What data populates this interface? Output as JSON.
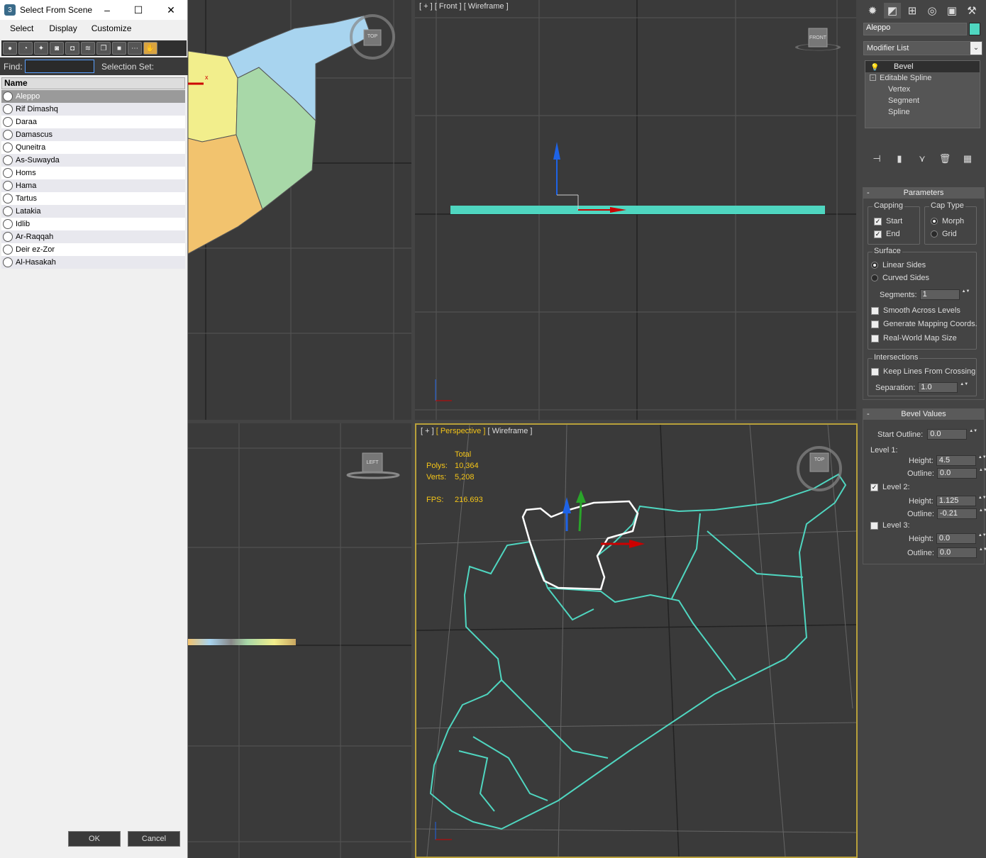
{
  "dialog": {
    "title": "Select From Scene",
    "menu": [
      "Select",
      "Display",
      "Customize"
    ],
    "find_label": "Find:",
    "find_value": "",
    "selection_set_label": "Selection Set:",
    "column_header": "Name",
    "items": [
      "Aleppo",
      "Rif Dimashq",
      "Daraa",
      "Damascus",
      "Quneitra",
      "As-Suwayda",
      "Homs",
      "Hama",
      "Tartus",
      "Latakia",
      "Idlib",
      "Ar-Raqqah",
      "Deir ez-Zor",
      "Al-Hasakah"
    ],
    "selected_index": 0,
    "ok_label": "OK",
    "cancel_label": "Cancel"
  },
  "viewports": {
    "top": {
      "cube_label": "TOP"
    },
    "front": {
      "plus": "[ + ]",
      "view": "[ Front ]",
      "shading": "[ Wireframe ]",
      "cube_label": "FRONT"
    },
    "left": {
      "cube_label": "LEFT"
    },
    "perspective": {
      "plus": "[ + ]",
      "view": "[ Perspective ]",
      "shading": "[ Wireframe ]",
      "cube_label": "TOP",
      "stats": {
        "total_label": "Total",
        "polys_label": "Polys:",
        "polys": "10,364",
        "verts_label": "Verts:",
        "verts": "5,208",
        "fps_label": "FPS:",
        "fps": "216.693"
      }
    }
  },
  "panel": {
    "object_name": "Aleppo",
    "object_color": "#4fd6c0",
    "modifier_list": "Modifier List",
    "stack": {
      "top": "Bevel",
      "base": "Editable Spline",
      "subs": [
        "Vertex",
        "Segment",
        "Spline"
      ]
    },
    "parameters": {
      "title": "Parameters",
      "capping": {
        "title": "Capping",
        "start": "Start",
        "end": "End"
      },
      "cap_type": {
        "title": "Cap Type",
        "morph": "Morph",
        "grid": "Grid"
      },
      "surface": {
        "title": "Surface",
        "linear": "Linear Sides",
        "curved": "Curved Sides",
        "segments_label": "Segments:",
        "segments": "1"
      },
      "smooth": "Smooth Across Levels",
      "gen_mapping": "Generate Mapping Coords.",
      "real_world": "Real-World Map Size",
      "intersections": {
        "title": "Intersections",
        "keep_lines": "Keep Lines From Crossing",
        "separation_label": "Separation:",
        "separation": "1.0"
      }
    },
    "bevel_values": {
      "title": "Bevel Values",
      "start_outline_label": "Start Outline:",
      "start_outline": "0.0",
      "level1": "Level 1:",
      "l1_height": "4.5",
      "l1_outline": "0.0",
      "level2": "Level 2:",
      "l2_height": "1.125",
      "l2_outline": "-0.21",
      "level3": "Level 3:",
      "l3_height": "0.0",
      "l3_outline": "0.0",
      "height_label": "Height:",
      "outline_label": "Outline:"
    }
  }
}
